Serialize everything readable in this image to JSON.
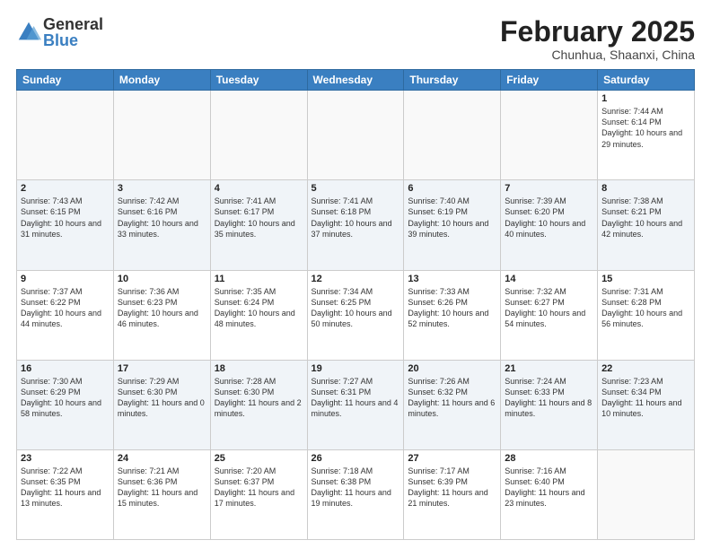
{
  "header": {
    "logo_general": "General",
    "logo_blue": "Blue",
    "month_title": "February 2025",
    "subtitle": "Chunhua, Shaanxi, China"
  },
  "weekdays": [
    "Sunday",
    "Monday",
    "Tuesday",
    "Wednesday",
    "Thursday",
    "Friday",
    "Saturday"
  ],
  "weeks": [
    [
      {
        "day": "",
        "info": ""
      },
      {
        "day": "",
        "info": ""
      },
      {
        "day": "",
        "info": ""
      },
      {
        "day": "",
        "info": ""
      },
      {
        "day": "",
        "info": ""
      },
      {
        "day": "",
        "info": ""
      },
      {
        "day": "1",
        "info": "Sunrise: 7:44 AM\nSunset: 6:14 PM\nDaylight: 10 hours and 29 minutes."
      }
    ],
    [
      {
        "day": "2",
        "info": "Sunrise: 7:43 AM\nSunset: 6:15 PM\nDaylight: 10 hours and 31 minutes."
      },
      {
        "day": "3",
        "info": "Sunrise: 7:42 AM\nSunset: 6:16 PM\nDaylight: 10 hours and 33 minutes."
      },
      {
        "day": "4",
        "info": "Sunrise: 7:41 AM\nSunset: 6:17 PM\nDaylight: 10 hours and 35 minutes."
      },
      {
        "day": "5",
        "info": "Sunrise: 7:41 AM\nSunset: 6:18 PM\nDaylight: 10 hours and 37 minutes."
      },
      {
        "day": "6",
        "info": "Sunrise: 7:40 AM\nSunset: 6:19 PM\nDaylight: 10 hours and 39 minutes."
      },
      {
        "day": "7",
        "info": "Sunrise: 7:39 AM\nSunset: 6:20 PM\nDaylight: 10 hours and 40 minutes."
      },
      {
        "day": "8",
        "info": "Sunrise: 7:38 AM\nSunset: 6:21 PM\nDaylight: 10 hours and 42 minutes."
      }
    ],
    [
      {
        "day": "9",
        "info": "Sunrise: 7:37 AM\nSunset: 6:22 PM\nDaylight: 10 hours and 44 minutes."
      },
      {
        "day": "10",
        "info": "Sunrise: 7:36 AM\nSunset: 6:23 PM\nDaylight: 10 hours and 46 minutes."
      },
      {
        "day": "11",
        "info": "Sunrise: 7:35 AM\nSunset: 6:24 PM\nDaylight: 10 hours and 48 minutes."
      },
      {
        "day": "12",
        "info": "Sunrise: 7:34 AM\nSunset: 6:25 PM\nDaylight: 10 hours and 50 minutes."
      },
      {
        "day": "13",
        "info": "Sunrise: 7:33 AM\nSunset: 6:26 PM\nDaylight: 10 hours and 52 minutes."
      },
      {
        "day": "14",
        "info": "Sunrise: 7:32 AM\nSunset: 6:27 PM\nDaylight: 10 hours and 54 minutes."
      },
      {
        "day": "15",
        "info": "Sunrise: 7:31 AM\nSunset: 6:28 PM\nDaylight: 10 hours and 56 minutes."
      }
    ],
    [
      {
        "day": "16",
        "info": "Sunrise: 7:30 AM\nSunset: 6:29 PM\nDaylight: 10 hours and 58 minutes."
      },
      {
        "day": "17",
        "info": "Sunrise: 7:29 AM\nSunset: 6:30 PM\nDaylight: 11 hours and 0 minutes."
      },
      {
        "day": "18",
        "info": "Sunrise: 7:28 AM\nSunset: 6:30 PM\nDaylight: 11 hours and 2 minutes."
      },
      {
        "day": "19",
        "info": "Sunrise: 7:27 AM\nSunset: 6:31 PM\nDaylight: 11 hours and 4 minutes."
      },
      {
        "day": "20",
        "info": "Sunrise: 7:26 AM\nSunset: 6:32 PM\nDaylight: 11 hours and 6 minutes."
      },
      {
        "day": "21",
        "info": "Sunrise: 7:24 AM\nSunset: 6:33 PM\nDaylight: 11 hours and 8 minutes."
      },
      {
        "day": "22",
        "info": "Sunrise: 7:23 AM\nSunset: 6:34 PM\nDaylight: 11 hours and 10 minutes."
      }
    ],
    [
      {
        "day": "23",
        "info": "Sunrise: 7:22 AM\nSunset: 6:35 PM\nDaylight: 11 hours and 13 minutes."
      },
      {
        "day": "24",
        "info": "Sunrise: 7:21 AM\nSunset: 6:36 PM\nDaylight: 11 hours and 15 minutes."
      },
      {
        "day": "25",
        "info": "Sunrise: 7:20 AM\nSunset: 6:37 PM\nDaylight: 11 hours and 17 minutes."
      },
      {
        "day": "26",
        "info": "Sunrise: 7:18 AM\nSunset: 6:38 PM\nDaylight: 11 hours and 19 minutes."
      },
      {
        "day": "27",
        "info": "Sunrise: 7:17 AM\nSunset: 6:39 PM\nDaylight: 11 hours and 21 minutes."
      },
      {
        "day": "28",
        "info": "Sunrise: 7:16 AM\nSunset: 6:40 PM\nDaylight: 11 hours and 23 minutes."
      },
      {
        "day": "",
        "info": ""
      }
    ]
  ]
}
